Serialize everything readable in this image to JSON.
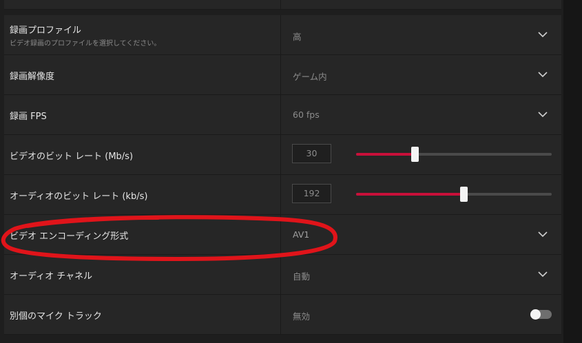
{
  "settings": [
    {
      "label": "録画プロファイル",
      "description": "ビデオ録画のプロファイルを選択してください。",
      "value": "高",
      "control": "dropdown"
    },
    {
      "label": "録画解像度",
      "value": "ゲーム内",
      "control": "dropdown"
    },
    {
      "label": "録画 FPS",
      "value": "60 fps",
      "control": "dropdown"
    },
    {
      "label": "ビデオのビット レート (Mb/s)",
      "value": "30",
      "control": "slider",
      "slider_fraction": 0.3
    },
    {
      "label": "オーディオのビット レート (kb/s)",
      "value": "192",
      "control": "slider",
      "slider_fraction": 0.55
    },
    {
      "label": "ビデオ エンコーディング形式",
      "value": "AV1",
      "control": "dropdown",
      "highlighted": true
    },
    {
      "label": "オーディオ チャネル",
      "value": "自動",
      "control": "dropdown"
    },
    {
      "label": "別個のマイク トラック",
      "value": "無効",
      "control": "toggle",
      "toggle_on": false
    }
  ],
  "colors": {
    "accent": "#c8103a",
    "annotation": "#e0141a",
    "row_background": "#262626",
    "page_background": "#1e1e1e"
  },
  "icons": {
    "dropdown": "chevron-down-icon"
  }
}
